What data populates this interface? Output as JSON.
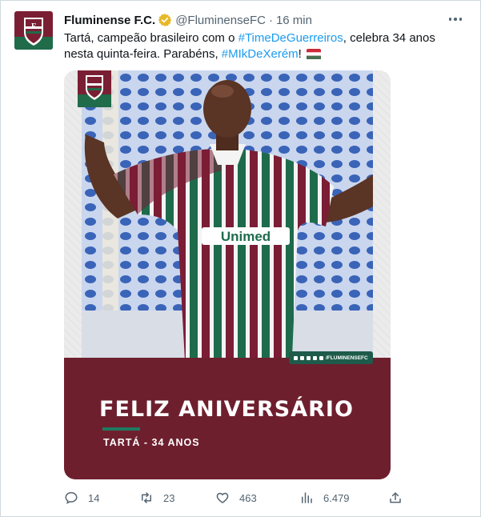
{
  "tweet": {
    "author_name": "Fluminense F.C.",
    "handle": "@FluminenseFC",
    "separator": "·",
    "time": "16 min",
    "text_1": "Tartá, campeão brasileiro com o ",
    "hashtag_1": "#TimeDeGuerreiros",
    "text_2": ", celebra 34 anos nesta quinta-feira. Parabéns, ",
    "hashtag_2": "#MIkDeXerém",
    "text_3": "!",
    "flag_emoji": "hungary-flag-emoji"
  },
  "media": {
    "social_handle": "/FLUMINENSEFC",
    "headline": "FELIZ ANIVERSÁRIO",
    "subline": "TARTÁ - 34 ANOS",
    "icons": [
      "facebook-icon",
      "instagram-icon",
      "twitter-icon",
      "youtube-icon",
      "tiktok-icon"
    ]
  },
  "actions": {
    "replies": "14",
    "retweets": "23",
    "likes": "463",
    "views": "6.479"
  },
  "colors": {
    "club_maroon": "#7a1f33",
    "club_green": "#1f6b4a",
    "link_blue": "#1d9bf0",
    "muted_text": "#536471",
    "verified_gold": "#e8b828"
  }
}
